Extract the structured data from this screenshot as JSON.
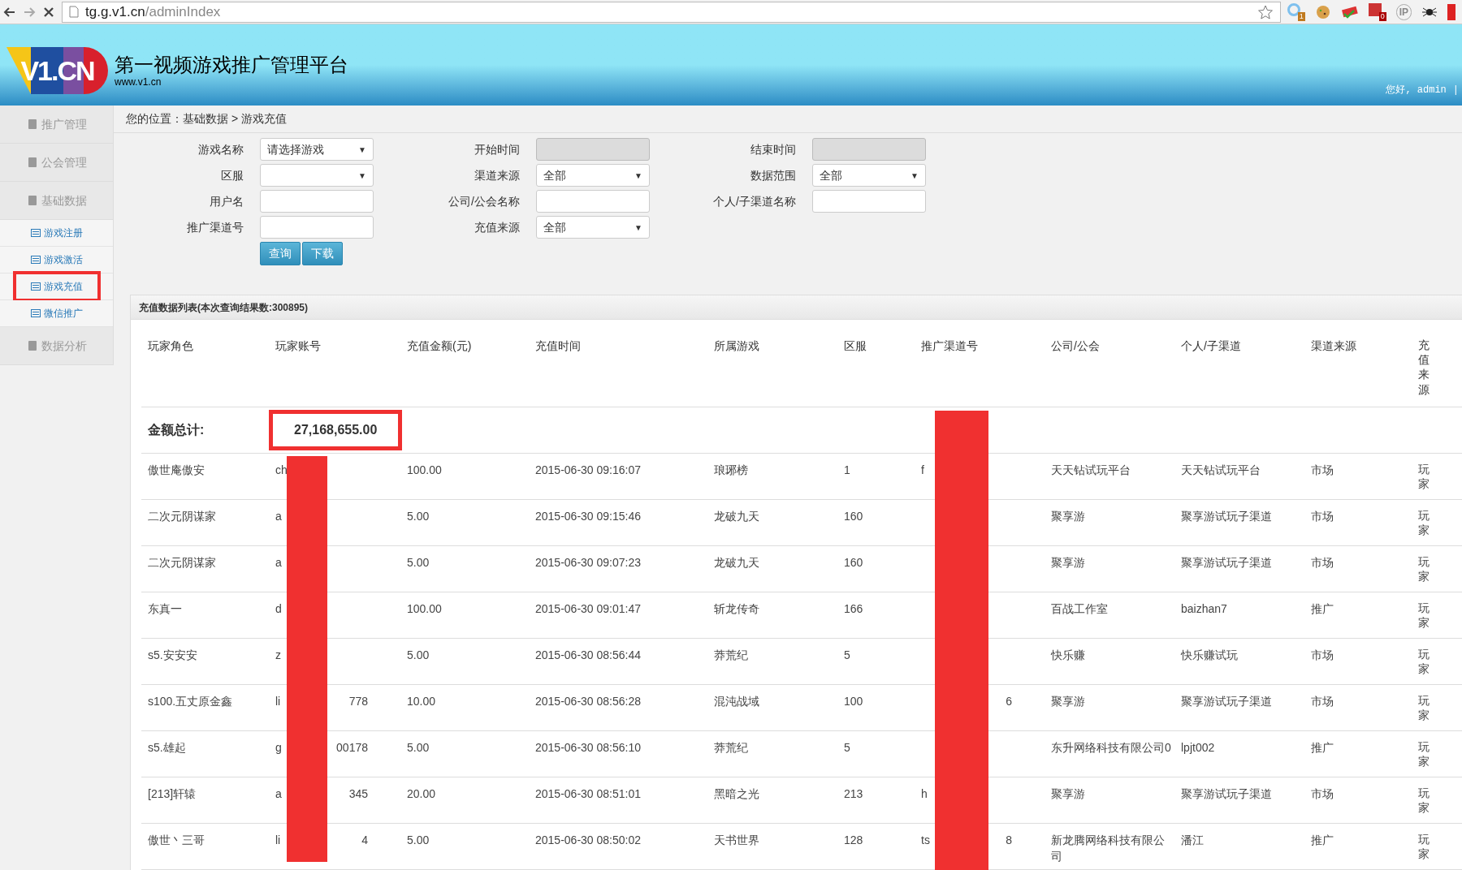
{
  "browser": {
    "url_host": "tg.g.v1.cn",
    "url_path": "/adminIndex",
    "badges": [
      "1",
      "0"
    ],
    "ip_label": "IP"
  },
  "header": {
    "logo": "V1.CN",
    "title": "第一视频游戏推广管理平台",
    "subtitle": "www.v1.cn",
    "greeting": "您好, admin",
    "separator": "|"
  },
  "sidebar": {
    "items": [
      {
        "label": "推广管理",
        "kind": "section",
        "selected": false
      },
      {
        "label": "公会管理",
        "kind": "section",
        "selected": false
      },
      {
        "label": "基础数据",
        "kind": "section",
        "selected": false
      },
      {
        "label": "游戏注册",
        "kind": "sub",
        "selected": false
      },
      {
        "label": "游戏激活",
        "kind": "sub",
        "selected": false
      },
      {
        "label": "游戏充值",
        "kind": "sub",
        "selected": true
      },
      {
        "label": "微信推广",
        "kind": "sub",
        "selected": false
      },
      {
        "label": "数据分析",
        "kind": "section",
        "selected": false
      }
    ]
  },
  "breadcrumb": "您的位置：基础数据 > 游戏充值",
  "filters": [
    {
      "label": "游戏名称",
      "kind": "select",
      "value": "请选择游戏",
      "caret": "▼",
      "disabled": false
    },
    {
      "label": "开始时间",
      "kind": "input",
      "disabled": true
    },
    {
      "label": "结束时间",
      "kind": "input",
      "disabled": true
    },
    {
      "label": "区服",
      "kind": "select",
      "caret": "▼",
      "disabled": false
    },
    {
      "label": "渠道来源",
      "kind": "select",
      "value": "全部",
      "caret": "▼",
      "disabled": false
    },
    {
      "label": "数据范围",
      "kind": "select",
      "value": "全部",
      "caret": "▼",
      "disabled": false
    },
    {
      "label": "用户名",
      "kind": "input",
      "disabled": false
    },
    {
      "label": "公司/公会名称",
      "kind": "input",
      "disabled": false
    },
    {
      "label": "个人/子渠道名称",
      "kind": "input",
      "disabled": false
    },
    {
      "label": "推广渠道号",
      "kind": "input",
      "disabled": false
    },
    {
      "label": "充值来源",
      "kind": "select",
      "value": "全部",
      "caret": "▼",
      "disabled": false
    }
  ],
  "buttons": [
    "查询",
    "下载"
  ],
  "table": {
    "title": "充值数据列表(本次查询结果数:300895)",
    "columns": [
      "玩家角色",
      "玩家账号",
      "充值金额(元)",
      "充值时间",
      "所属游戏",
      "区服",
      "推广渠道号",
      "公司/公会",
      "个人/子渠道",
      "渠道来源",
      "充值来源"
    ],
    "total_label": "金额总计:",
    "total_value": "27,168,655.00",
    "rows": [
      {
        "role": "傲世庵傲安",
        "account": {
          "start": "ch"
        },
        "amount": "100.00",
        "time": "2015-06-30 09:16:07",
        "game": "琅琊榜",
        "server": "1",
        "channel": {
          "start": "f"
        },
        "company": "天天钻试玩平台",
        "person": "天天钻试玩平台",
        "source": "市场",
        "pay_source": "玩家"
      },
      {
        "role": "二次元阴谋家",
        "account": {
          "start": "a"
        },
        "amount": "5.00",
        "time": "2015-06-30 09:15:46",
        "game": "龙破九天",
        "server": "160",
        "company": "聚享游",
        "person": "聚享游试玩子渠道",
        "source": "市场",
        "pay_source": "玩家"
      },
      {
        "role": "二次元阴谋家",
        "account": {
          "start": "a"
        },
        "amount": "5.00",
        "time": "2015-06-30 09:07:23",
        "game": "龙破九天",
        "server": "160",
        "company": "聚享游",
        "person": "聚享游试玩子渠道",
        "source": "市场",
        "pay_source": "玩家"
      },
      {
        "role": "东真一",
        "account": {
          "start": "d"
        },
        "amount": "100.00",
        "time": "2015-06-30 09:01:47",
        "game": "斩龙传奇",
        "server": "166",
        "company": "百战工作室",
        "person": "baizhan7",
        "source": "推广",
        "pay_source": "玩家"
      },
      {
        "role": "s5.安安安",
        "account": {
          "start": "z"
        },
        "amount": "5.00",
        "time": "2015-06-30 08:56:44",
        "game": "莽荒纪",
        "server": "5",
        "company": "快乐赚",
        "person": "快乐赚试玩",
        "source": "市场",
        "pay_source": "玩家"
      },
      {
        "role": "s100.五丈原金鑫",
        "account": {
          "start": "li",
          "end": "778"
        },
        "amount": "10.00",
        "time": "2015-06-30 08:56:28",
        "game": "混沌战域",
        "server": "100",
        "channel": {
          "end": "6"
        },
        "company": "聚享游",
        "person": "聚享游试玩子渠道",
        "source": "市场",
        "pay_source": "玩家"
      },
      {
        "role": "s5.雄起",
        "account": {
          "start": "g",
          "end": "00178"
        },
        "amount": "5.00",
        "time": "2015-06-30 08:56:10",
        "game": "莽荒纪",
        "server": "5",
        "company": "东升网络科技有限公司0",
        "person": "lpjt002",
        "source": "推广",
        "pay_source": "玩家"
      },
      {
        "role": "[213]轩辕",
        "account": {
          "start": "a",
          "end": "345"
        },
        "amount": "20.00",
        "time": "2015-06-30 08:51:01",
        "game": "黑暗之光",
        "server": "213",
        "channel": {
          "start": "h"
        },
        "company": "聚享游",
        "person": "聚享游试玩子渠道",
        "source": "市场",
        "pay_source": "玩家"
      },
      {
        "role": "傲世丶三哥",
        "account": {
          "start": "li",
          "end": "4"
        },
        "amount": "5.00",
        "time": "2015-06-30 08:50:02",
        "game": "天书世界",
        "server": "128",
        "channel": {
          "start": "ts",
          "end": "8"
        },
        "company": "新龙腾网络科技有限公司",
        "person": "潘江",
        "source": "推广",
        "pay_source": "玩家"
      }
    ]
  }
}
